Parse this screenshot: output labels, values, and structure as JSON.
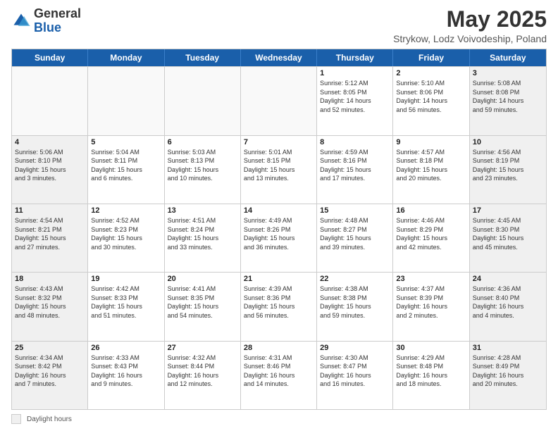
{
  "header": {
    "logo_general": "General",
    "logo_blue": "Blue",
    "month_title": "May 2025",
    "location": "Strykow, Lodz Voivodeship, Poland"
  },
  "days_of_week": [
    "Sunday",
    "Monday",
    "Tuesday",
    "Wednesday",
    "Thursday",
    "Friday",
    "Saturday"
  ],
  "footer": {
    "label": "Daylight hours"
  },
  "weeks": [
    [
      {
        "day": "",
        "info": "",
        "empty": true
      },
      {
        "day": "",
        "info": "",
        "empty": true
      },
      {
        "day": "",
        "info": "",
        "empty": true
      },
      {
        "day": "",
        "info": "",
        "empty": true
      },
      {
        "day": "1",
        "info": "Sunrise: 5:12 AM\nSunset: 8:05 PM\nDaylight: 14 hours\nand 52 minutes.",
        "empty": false
      },
      {
        "day": "2",
        "info": "Sunrise: 5:10 AM\nSunset: 8:06 PM\nDaylight: 14 hours\nand 56 minutes.",
        "empty": false
      },
      {
        "day": "3",
        "info": "Sunrise: 5:08 AM\nSunset: 8:08 PM\nDaylight: 14 hours\nand 59 minutes.",
        "empty": false
      }
    ],
    [
      {
        "day": "4",
        "info": "Sunrise: 5:06 AM\nSunset: 8:10 PM\nDaylight: 15 hours\nand 3 minutes.",
        "empty": false
      },
      {
        "day": "5",
        "info": "Sunrise: 5:04 AM\nSunset: 8:11 PM\nDaylight: 15 hours\nand 6 minutes.",
        "empty": false
      },
      {
        "day": "6",
        "info": "Sunrise: 5:03 AM\nSunset: 8:13 PM\nDaylight: 15 hours\nand 10 minutes.",
        "empty": false
      },
      {
        "day": "7",
        "info": "Sunrise: 5:01 AM\nSunset: 8:15 PM\nDaylight: 15 hours\nand 13 minutes.",
        "empty": false
      },
      {
        "day": "8",
        "info": "Sunrise: 4:59 AM\nSunset: 8:16 PM\nDaylight: 15 hours\nand 17 minutes.",
        "empty": false
      },
      {
        "day": "9",
        "info": "Sunrise: 4:57 AM\nSunset: 8:18 PM\nDaylight: 15 hours\nand 20 minutes.",
        "empty": false
      },
      {
        "day": "10",
        "info": "Sunrise: 4:56 AM\nSunset: 8:19 PM\nDaylight: 15 hours\nand 23 minutes.",
        "empty": false
      }
    ],
    [
      {
        "day": "11",
        "info": "Sunrise: 4:54 AM\nSunset: 8:21 PM\nDaylight: 15 hours\nand 27 minutes.",
        "empty": false
      },
      {
        "day": "12",
        "info": "Sunrise: 4:52 AM\nSunset: 8:23 PM\nDaylight: 15 hours\nand 30 minutes.",
        "empty": false
      },
      {
        "day": "13",
        "info": "Sunrise: 4:51 AM\nSunset: 8:24 PM\nDaylight: 15 hours\nand 33 minutes.",
        "empty": false
      },
      {
        "day": "14",
        "info": "Sunrise: 4:49 AM\nSunset: 8:26 PM\nDaylight: 15 hours\nand 36 minutes.",
        "empty": false
      },
      {
        "day": "15",
        "info": "Sunrise: 4:48 AM\nSunset: 8:27 PM\nDaylight: 15 hours\nand 39 minutes.",
        "empty": false
      },
      {
        "day": "16",
        "info": "Sunrise: 4:46 AM\nSunset: 8:29 PM\nDaylight: 15 hours\nand 42 minutes.",
        "empty": false
      },
      {
        "day": "17",
        "info": "Sunrise: 4:45 AM\nSunset: 8:30 PM\nDaylight: 15 hours\nand 45 minutes.",
        "empty": false
      }
    ],
    [
      {
        "day": "18",
        "info": "Sunrise: 4:43 AM\nSunset: 8:32 PM\nDaylight: 15 hours\nand 48 minutes.",
        "empty": false
      },
      {
        "day": "19",
        "info": "Sunrise: 4:42 AM\nSunset: 8:33 PM\nDaylight: 15 hours\nand 51 minutes.",
        "empty": false
      },
      {
        "day": "20",
        "info": "Sunrise: 4:41 AM\nSunset: 8:35 PM\nDaylight: 15 hours\nand 54 minutes.",
        "empty": false
      },
      {
        "day": "21",
        "info": "Sunrise: 4:39 AM\nSunset: 8:36 PM\nDaylight: 15 hours\nand 56 minutes.",
        "empty": false
      },
      {
        "day": "22",
        "info": "Sunrise: 4:38 AM\nSunset: 8:38 PM\nDaylight: 15 hours\nand 59 minutes.",
        "empty": false
      },
      {
        "day": "23",
        "info": "Sunrise: 4:37 AM\nSunset: 8:39 PM\nDaylight: 16 hours\nand 2 minutes.",
        "empty": false
      },
      {
        "day": "24",
        "info": "Sunrise: 4:36 AM\nSunset: 8:40 PM\nDaylight: 16 hours\nand 4 minutes.",
        "empty": false
      }
    ],
    [
      {
        "day": "25",
        "info": "Sunrise: 4:34 AM\nSunset: 8:42 PM\nDaylight: 16 hours\nand 7 minutes.",
        "empty": false
      },
      {
        "day": "26",
        "info": "Sunrise: 4:33 AM\nSunset: 8:43 PM\nDaylight: 16 hours\nand 9 minutes.",
        "empty": false
      },
      {
        "day": "27",
        "info": "Sunrise: 4:32 AM\nSunset: 8:44 PM\nDaylight: 16 hours\nand 12 minutes.",
        "empty": false
      },
      {
        "day": "28",
        "info": "Sunrise: 4:31 AM\nSunset: 8:46 PM\nDaylight: 16 hours\nand 14 minutes.",
        "empty": false
      },
      {
        "day": "29",
        "info": "Sunrise: 4:30 AM\nSunset: 8:47 PM\nDaylight: 16 hours\nand 16 minutes.",
        "empty": false
      },
      {
        "day": "30",
        "info": "Sunrise: 4:29 AM\nSunset: 8:48 PM\nDaylight: 16 hours\nand 18 minutes.",
        "empty": false
      },
      {
        "day": "31",
        "info": "Sunrise: 4:28 AM\nSunset: 8:49 PM\nDaylight: 16 hours\nand 20 minutes.",
        "empty": false
      }
    ]
  ]
}
